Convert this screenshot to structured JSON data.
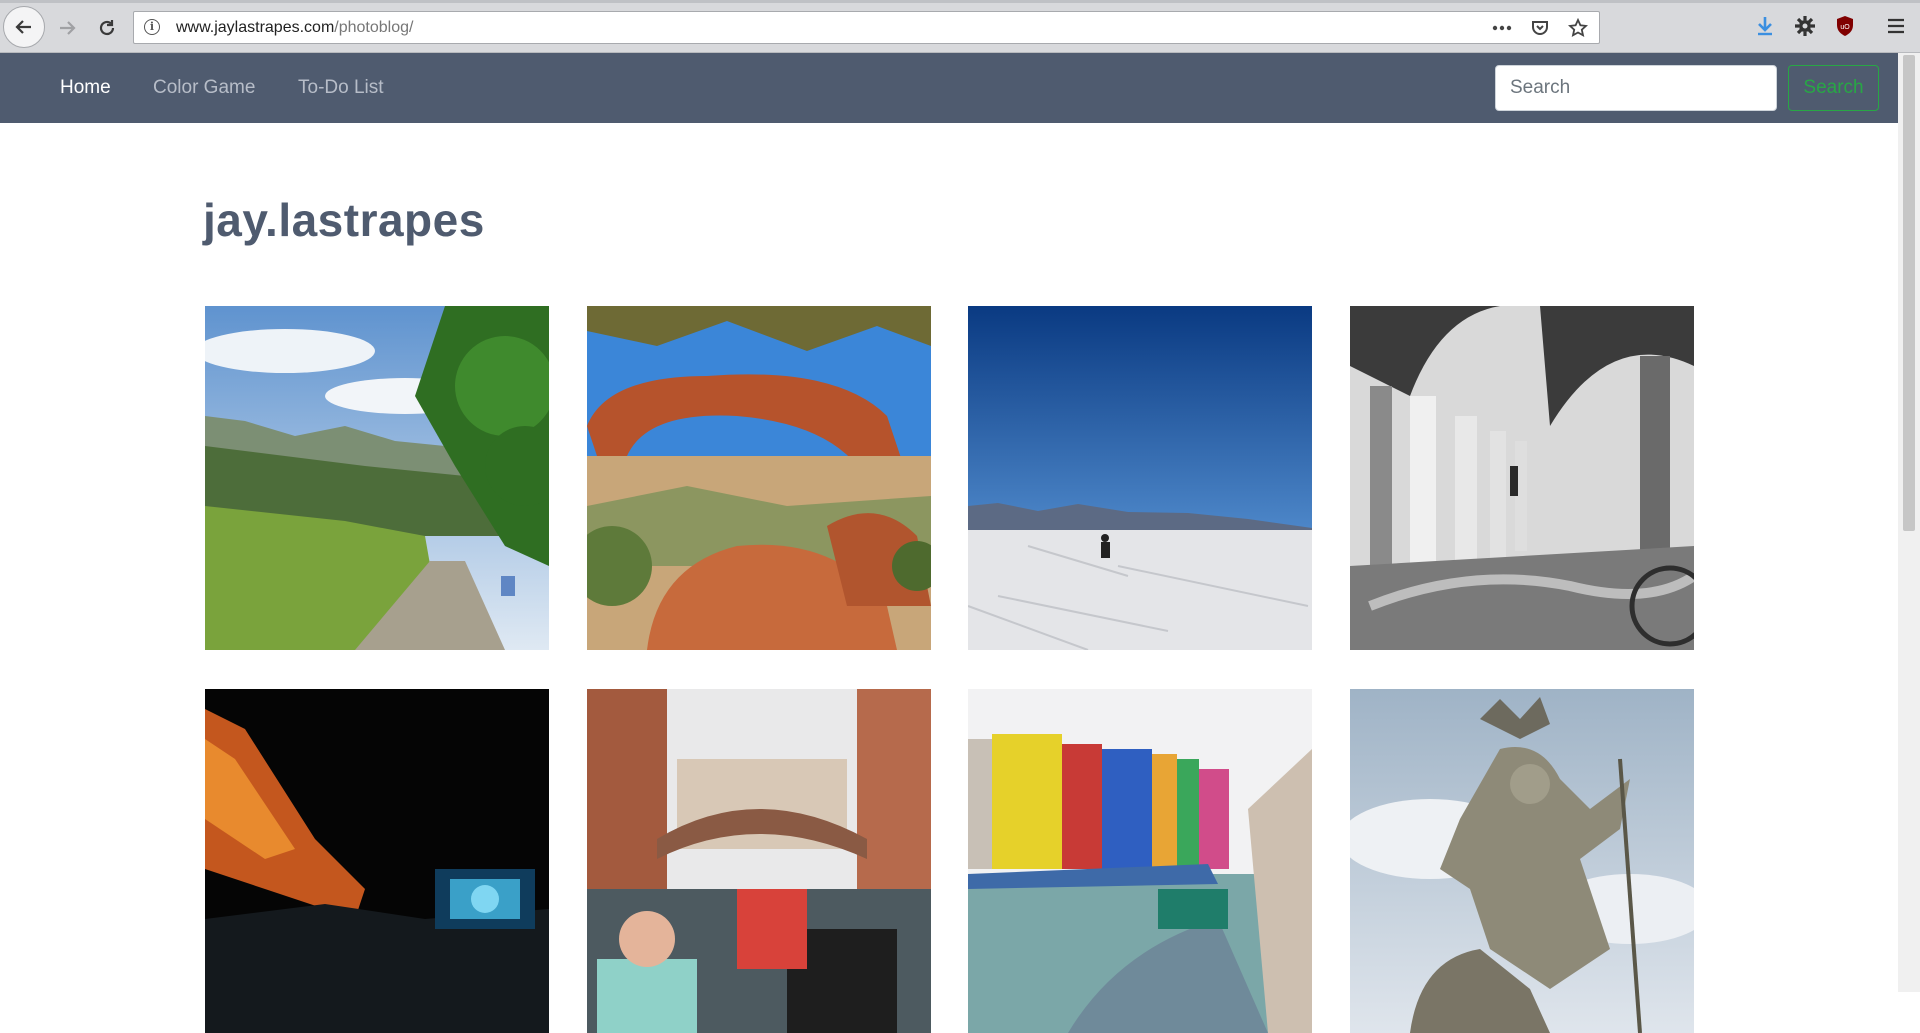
{
  "browser": {
    "url_host": "www.jaylastrapes.com",
    "url_path": "/photoblog/",
    "icons": [
      "back-arrow-icon",
      "forward-arrow-icon",
      "reload-icon",
      "info-icon",
      "more-dots-icon",
      "pocket-icon",
      "bookmark-star-icon",
      "download-arrow-icon",
      "gear-icon",
      "ublock-shield-icon",
      "hamburger-menu-icon"
    ]
  },
  "navbar": {
    "links": [
      {
        "label": "Home",
        "active": true
      },
      {
        "label": "Color Game",
        "active": false
      },
      {
        "label": "To-Do List",
        "active": false
      }
    ],
    "search": {
      "placeholder": "Search",
      "button_label": "Search"
    },
    "colors": {
      "background": "#4f5b6f",
      "active_link": "#ffffff",
      "link": "#b7bdc8",
      "search_button": "#28a745"
    }
  },
  "page": {
    "title": "jay.lastrapes",
    "photos": [
      {
        "name": "mountain-trail-photo"
      },
      {
        "name": "desert-arch-photo"
      },
      {
        "name": "salt-flats-walker-photo"
      },
      {
        "name": "colonnade-bw-photo"
      },
      {
        "name": "red-rocks-concert-photo"
      },
      {
        "name": "venice-gondola-photo"
      },
      {
        "name": "burano-canal-photo"
      },
      {
        "name": "knight-statue-photo"
      }
    ]
  }
}
